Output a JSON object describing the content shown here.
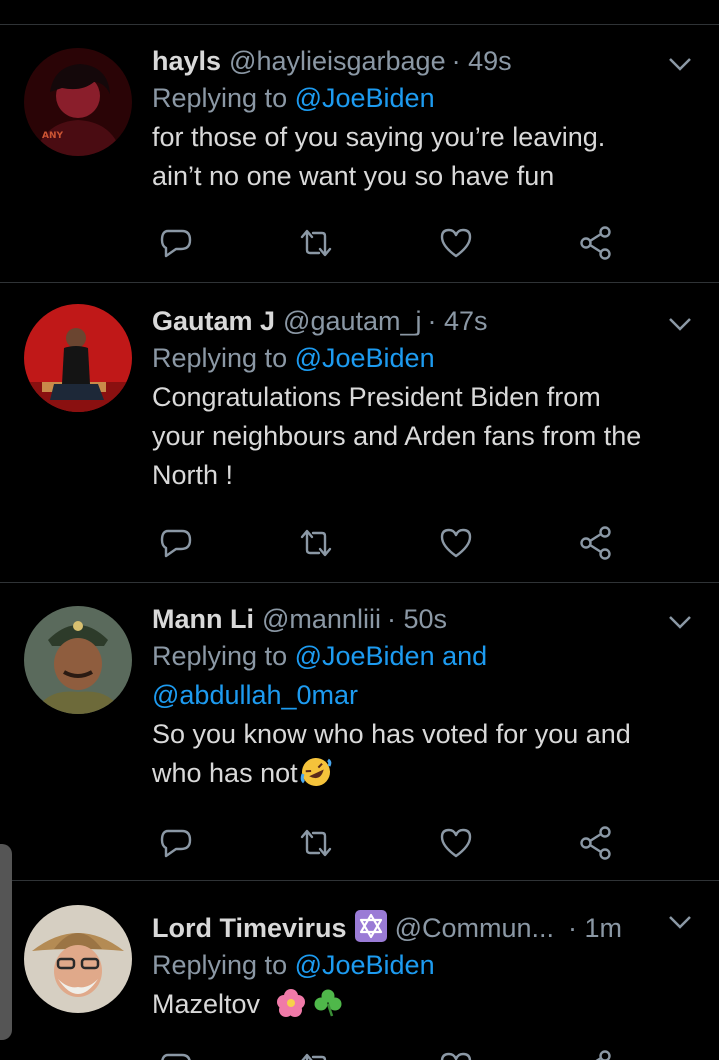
{
  "tweets": [
    {
      "name": "hayls",
      "handle": "@haylieisgarbage",
      "time": "· 49s",
      "replying_prefix": "Replying to ",
      "replying_to": "@JoeBiden",
      "text_lines": [
        "for those of you saying you’re leaving.",
        "ain’t no one want you so have fun"
      ]
    },
    {
      "name": "Gautam J",
      "handle": "@gautam_j",
      "time": "· 47s",
      "replying_prefix": "Replying to ",
      "replying_to": "@JoeBiden",
      "text_lines": [
        "Congratulations President Biden from",
        "your neighbours and Arden fans from the",
        "North !"
      ]
    },
    {
      "name": "Mann Li",
      "handle": "@mannliii",
      "time": "· 50s",
      "replying_prefix": "Replying to ",
      "replying_to": "@JoeBiden and",
      "replying_to_2": "@abdullah_0mar",
      "text_lines": [
        "So you know who has voted for you and",
        "who has not"
      ]
    },
    {
      "name": "Lord Timevirus",
      "handle": "@Commun...",
      "time": "· 1m",
      "replying_prefix": "Replying to ",
      "replying_to": "@JoeBiden",
      "text_lines": [
        "Mazeltov"
      ]
    }
  ],
  "icons": {
    "reply": "reply-icon",
    "retweet": "retweet-icon",
    "like": "heart-icon",
    "share": "share-icon",
    "menu": "chevron-down-icon"
  },
  "colors": {
    "background": "#000000",
    "text": "#d9d9d9",
    "secondary": "#8b98a5",
    "accent": "#1d9bf0",
    "divider": "#2f3336"
  }
}
